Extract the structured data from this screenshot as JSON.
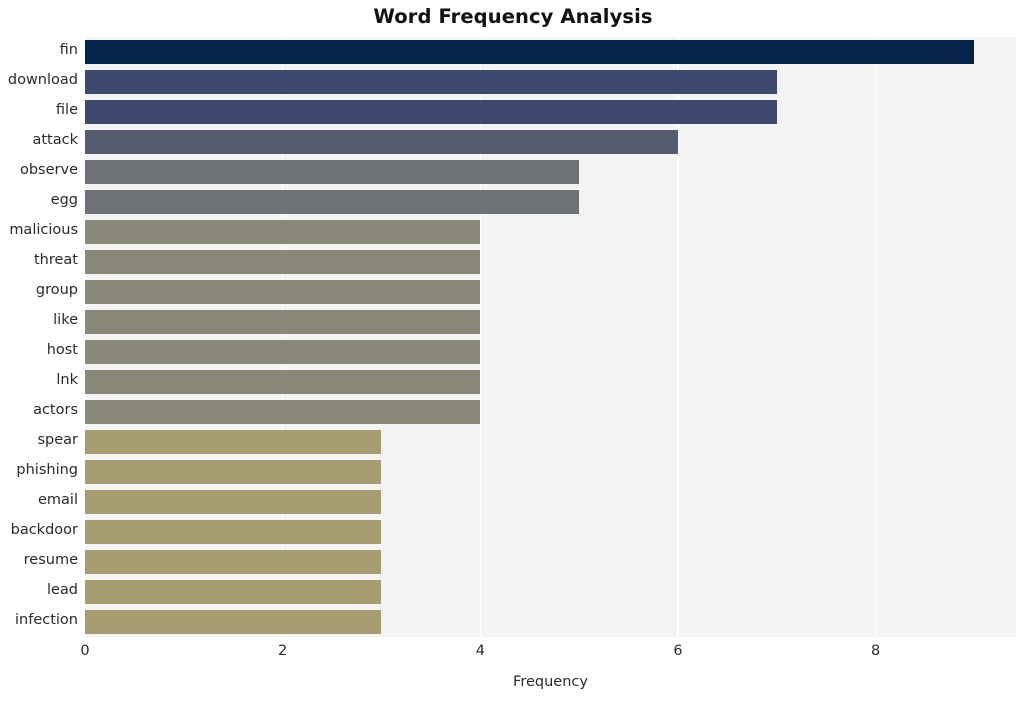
{
  "chart_data": {
    "type": "bar",
    "orientation": "horizontal",
    "title": "Word Frequency Analysis",
    "xlabel": "Frequency",
    "ylabel": "",
    "categories": [
      "fin",
      "download",
      "file",
      "attack",
      "observe",
      "egg",
      "malicious",
      "threat",
      "group",
      "like",
      "host",
      "lnk",
      "actors",
      "spear",
      "phishing",
      "email",
      "backdoor",
      "resume",
      "lead",
      "infection"
    ],
    "values": [
      9,
      7,
      7,
      6,
      5,
      5,
      4,
      4,
      4,
      4,
      4,
      4,
      4,
      3,
      3,
      3,
      3,
      3,
      3,
      3
    ],
    "bar_colors": [
      "#042349",
      "#3e4a6d",
      "#3e4a6d",
      "#565c70",
      "#6e7175",
      "#6e7175",
      "#8a8878",
      "#8a8878",
      "#8a8878",
      "#8a8878",
      "#8a8878",
      "#8a8878",
      "#8a8878",
      "#a89d72",
      "#a89d72",
      "#a89d72",
      "#a89d72",
      "#a89d72",
      "#a89d72",
      "#a89d72"
    ],
    "xticks": [
      0,
      2,
      4,
      6,
      8
    ],
    "xtick_labels": [
      "0",
      "2",
      "4",
      "6",
      "8"
    ],
    "xlim": [
      0,
      9.42
    ],
    "grid": true,
    "grid_axis": "x",
    "legend": "none",
    "style": {
      "plot_background": "#f4f4f5",
      "figure_background": "#ffffff",
      "gridline_color": "#ffffff",
      "tick_label_color": "#2a2a2a",
      "title_color": "#101010"
    }
  }
}
